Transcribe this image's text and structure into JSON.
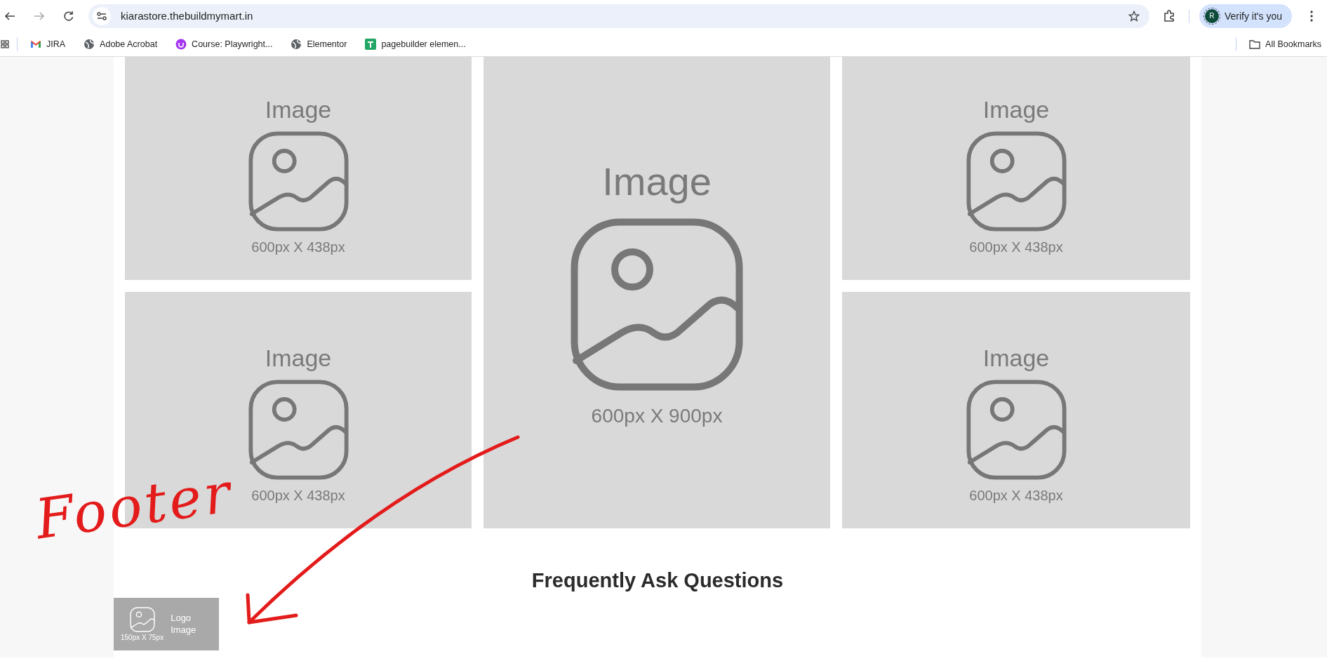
{
  "browser": {
    "url": "kiarastore.thebuildmymart.in",
    "profile": {
      "initial": "R",
      "label": "Verify it's you"
    }
  },
  "bookmarks": [
    {
      "label": "JIRA",
      "kind": "mail"
    },
    {
      "label": "Adobe Acrobat",
      "kind": "globe"
    },
    {
      "label": "Course: Playwright...",
      "kind": "course"
    },
    {
      "label": "Elementor",
      "kind": "globe"
    },
    {
      "label": "pagebuilder elemen...",
      "kind": "sheet"
    }
  ],
  "all_bookmarks": "All Bookmarks",
  "gallery": [
    {
      "kind": "small",
      "title": "Image",
      "size": "600px X 438px"
    },
    {
      "kind": "tall",
      "title": "Image",
      "size": "600px X 900px"
    },
    {
      "kind": "small",
      "title": "Image",
      "size": "600px X 438px"
    },
    {
      "kind": "small",
      "title": "Image",
      "size": "600px X 438px"
    },
    {
      "kind": "small",
      "title": "Image",
      "size": "600px X 438px"
    }
  ],
  "faq": {
    "heading": "Frequently Ask Questions"
  },
  "footer": {
    "logo": {
      "size": "150px X 75px",
      "label": "Logo Image"
    }
  },
  "annotation": {
    "text": "Footer"
  }
}
